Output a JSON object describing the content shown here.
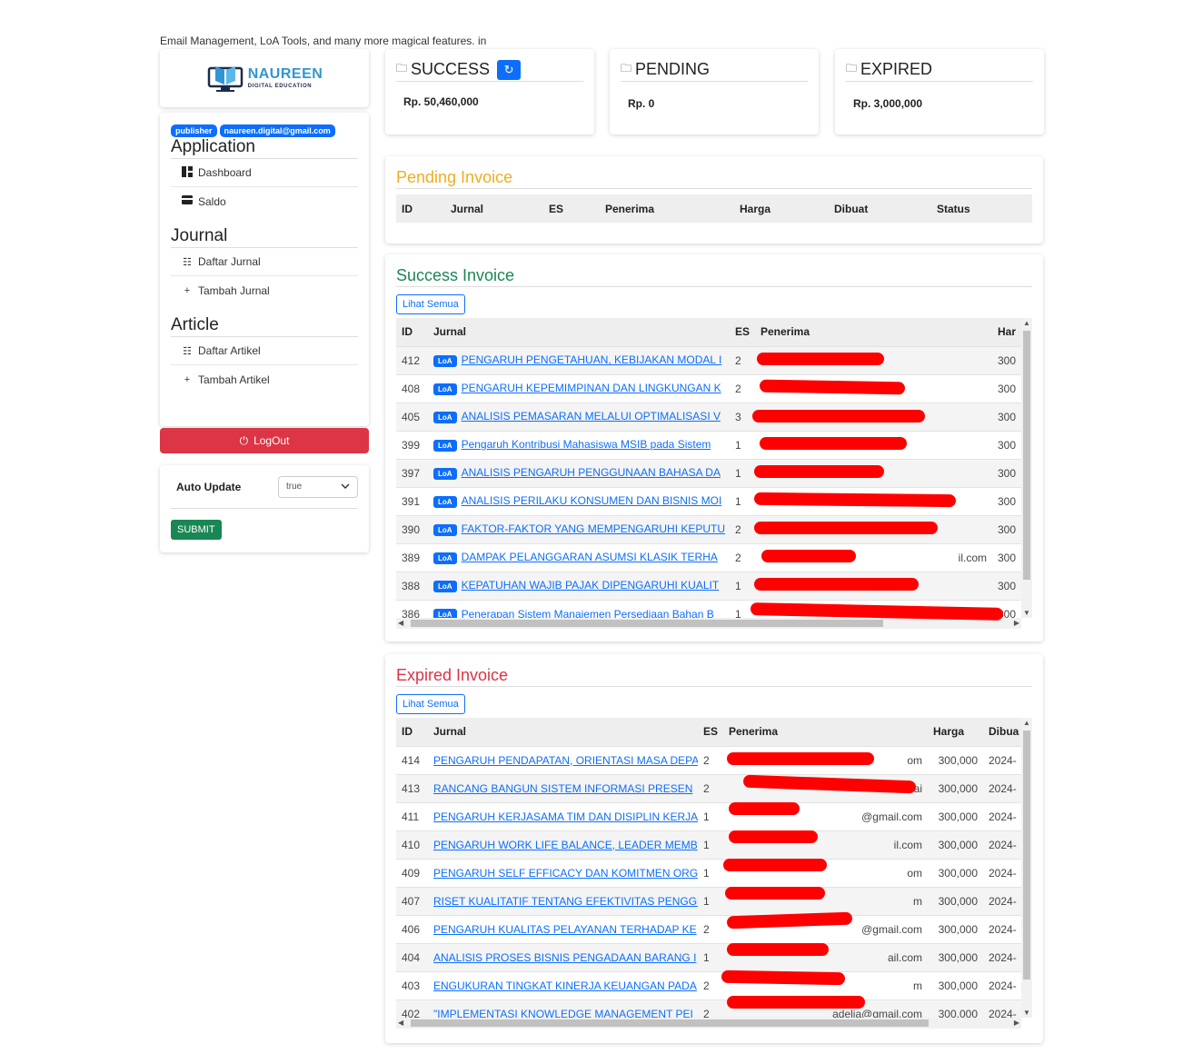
{
  "tagline": "Email Management, LoA Tools, and many more magical features. in",
  "logo": {
    "main": "NAUREEN",
    "sub": "DIGITAL EDUCATION"
  },
  "user": {
    "role": "publisher",
    "email": "naureen.digital@gmail.com"
  },
  "menu": {
    "application": {
      "title": "Application",
      "items": [
        {
          "icon": "dashboard-icon",
          "label": "Dashboard"
        },
        {
          "icon": "card-icon",
          "label": "Saldo"
        }
      ]
    },
    "journal": {
      "title": "Journal",
      "items": [
        {
          "icon": "list-icon",
          "label": "Daftar Jurnal"
        },
        {
          "icon": "plus-icon",
          "label": "Tambah Jurnal"
        }
      ]
    },
    "article": {
      "title": "Article",
      "items": [
        {
          "icon": "list-icon",
          "label": "Daftar Artikel"
        },
        {
          "icon": "plus-icon",
          "label": "Tambah Artikel"
        }
      ]
    }
  },
  "logout": "LogOut",
  "auto_update": {
    "label": "Auto Update",
    "value": "true",
    "submit": "SUBMIT"
  },
  "stats": {
    "success": {
      "title": "SUCCESS",
      "value": "Rp. 50,460,000"
    },
    "pending": {
      "title": "PENDING",
      "value": "Rp. 0"
    },
    "expired": {
      "title": "EXPIRED",
      "value": "Rp. 3,000,000"
    }
  },
  "pending_invoice": {
    "title": "Pending Invoice",
    "headers": [
      "ID",
      "Jurnal",
      "ES",
      "Penerima",
      "Harga",
      "Dibuat",
      "Status"
    ]
  },
  "success_invoice": {
    "title": "Success Invoice",
    "lihat": "Lihat Semua",
    "headers": [
      "ID",
      "Jurnal",
      "ES",
      "Penerima",
      "Har"
    ],
    "badge": "LoA",
    "rows": [
      {
        "id": "412",
        "jurnal": "PENGARUH PENGETAHUAN, KEBIJAKAN MODAL I",
        "es": "2",
        "penerima": "",
        "harga": "300"
      },
      {
        "id": "408",
        "jurnal": "PENGARUH KEPEMIMPINAN DAN LINGKUNGAN K",
        "es": "2",
        "penerima": "",
        "harga": "300"
      },
      {
        "id": "405",
        "jurnal": "ANALISIS PEMASARAN MELALUI OPTIMALISASI V",
        "es": "3",
        "penerima": "",
        "harga": "300"
      },
      {
        "id": "399",
        "jurnal": "Pengaruh Kontribusi Mahasiswa MSIB pada Sistem",
        "es": "1",
        "penerima": "",
        "harga": "300"
      },
      {
        "id": "397",
        "jurnal": "ANALISIS PENGARUH PENGGUNAAN BAHASA DA",
        "es": "1",
        "penerima": "",
        "harga": "300"
      },
      {
        "id": "391",
        "jurnal": "ANALISIS PERILAKU KONSUMEN DAN BISNIS MOI",
        "es": "1",
        "penerima": "",
        "harga": "300"
      },
      {
        "id": "390",
        "jurnal": "FAKTOR-FAKTOR YANG MEMPENGARUHI KEPUTU",
        "es": "2",
        "penerima": "",
        "harga": "300"
      },
      {
        "id": "389",
        "jurnal": "DAMPAK PELANGGARAN ASUMSI KLASIK TERHA",
        "es": "2",
        "penerima": "il.com",
        "harga": "300"
      },
      {
        "id": "388",
        "jurnal": "KEPATUHAN WAJIB PAJAK DIPENGARUHI KUALIT",
        "es": "1",
        "penerima": "",
        "harga": "300"
      },
      {
        "id": "386",
        "jurnal": "Penerapan Sistem Manajemen Persediaan Bahan B",
        "es": "1",
        "penerima": "ac.id",
        "harga": "300"
      }
    ]
  },
  "expired_invoice": {
    "title": "Expired Invoice",
    "lihat": "Lihat Semua",
    "headers": [
      "ID",
      "Jurnal",
      "ES",
      "Penerima",
      "Harga",
      "Dibua"
    ],
    "rows": [
      {
        "id": "414",
        "jurnal": "PENGARUH PENDAPATAN, ORIENTASI MASA DEPA",
        "es": "2",
        "penerima": "om",
        "harga": "300,000",
        "dibuat": "2024-"
      },
      {
        "id": "413",
        "jurnal": "RANCANG BANGUN SISTEM INFORMASI PRESEN",
        "es": "2",
        "penerima": "sai",
        "harga": "300,000",
        "dibuat": "2024-"
      },
      {
        "id": "411",
        "jurnal": "PENGARUH KERJASAMA TIM DAN DISIPLIN KERJA",
        "es": "1",
        "penerima": "@gmail.com",
        "harga": "300,000",
        "dibuat": "2024-"
      },
      {
        "id": "410",
        "jurnal": "PENGARUH WORK LIFE BALANCE, LEADER MEMB",
        "es": "1",
        "penerima": "il.com",
        "harga": "300,000",
        "dibuat": "2024-"
      },
      {
        "id": "409",
        "jurnal": "PENGARUH SELF EFFICACY DAN KOMITMEN ORG",
        "es": "1",
        "penerima": "om",
        "harga": "300,000",
        "dibuat": "2024-"
      },
      {
        "id": "407",
        "jurnal": "RISET KUALITATIF TENTANG EFEKTIVITAS PENGGU",
        "es": "1",
        "penerima": "m",
        "harga": "300,000",
        "dibuat": "2024-"
      },
      {
        "id": "406",
        "jurnal": "PENGARUH KUALITAS PELAYANAN TERHADAP KE",
        "es": "2",
        "penerima": "@gmail.com",
        "harga": "300,000",
        "dibuat": "2024-"
      },
      {
        "id": "404",
        "jurnal": "ANALISIS PROSES BISNIS PENGADAAN BARANG I",
        "es": "1",
        "penerima": "ail.com",
        "harga": "300,000",
        "dibuat": "2024-"
      },
      {
        "id": "403",
        "jurnal": "ENGUKURAN TINGKAT KINERJA KEUANGAN PADA",
        "es": "2",
        "penerima": "m",
        "harga": "300,000",
        "dibuat": "2024-"
      },
      {
        "id": "402",
        "jurnal": "\"IMPLEMENTASI KNOWLEDGE MANAGEMENT PEI",
        "es": "2",
        "penerima": "adelia@gmail.com",
        "harga": "300,000",
        "dibuat": "2024-"
      }
    ]
  }
}
